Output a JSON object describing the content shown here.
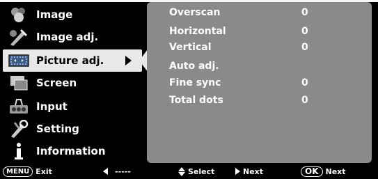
{
  "sidebar": {
    "items": [
      {
        "label": "Image",
        "icon": "image-icon"
      },
      {
        "label": "Image adj.",
        "icon": "image-adj-icon"
      },
      {
        "label": "Picture adj.",
        "icon": "picture-adj-icon"
      },
      {
        "label": "Screen",
        "icon": "screen-icon"
      },
      {
        "label": "Input",
        "icon": "input-icon"
      },
      {
        "label": "Setting",
        "icon": "setting-icon"
      },
      {
        "label": "Information",
        "icon": "information-icon"
      }
    ],
    "selected_index": 2
  },
  "panel": {
    "rows": [
      {
        "label": "Overscan",
        "value": "0"
      },
      {
        "label": "Horizontal",
        "value": "0"
      },
      {
        "label": "Vertical",
        "value": "0"
      },
      {
        "label": "Auto adj.",
        "value": ""
      },
      {
        "label": "Fine sync",
        "value": "0"
      },
      {
        "label": "Total dots",
        "value": "0"
      }
    ]
  },
  "footer": {
    "menu_key": "MENU",
    "exit_label": "Exit",
    "back_dashes": "-----",
    "select_label": "Select",
    "next_label": "Next",
    "ok_key": "OK",
    "ok_next_label": "Next"
  },
  "colors": {
    "panel_bg": "#8a8a8a",
    "selected_bg": "#e8e8e8",
    "background": "#000000"
  }
}
